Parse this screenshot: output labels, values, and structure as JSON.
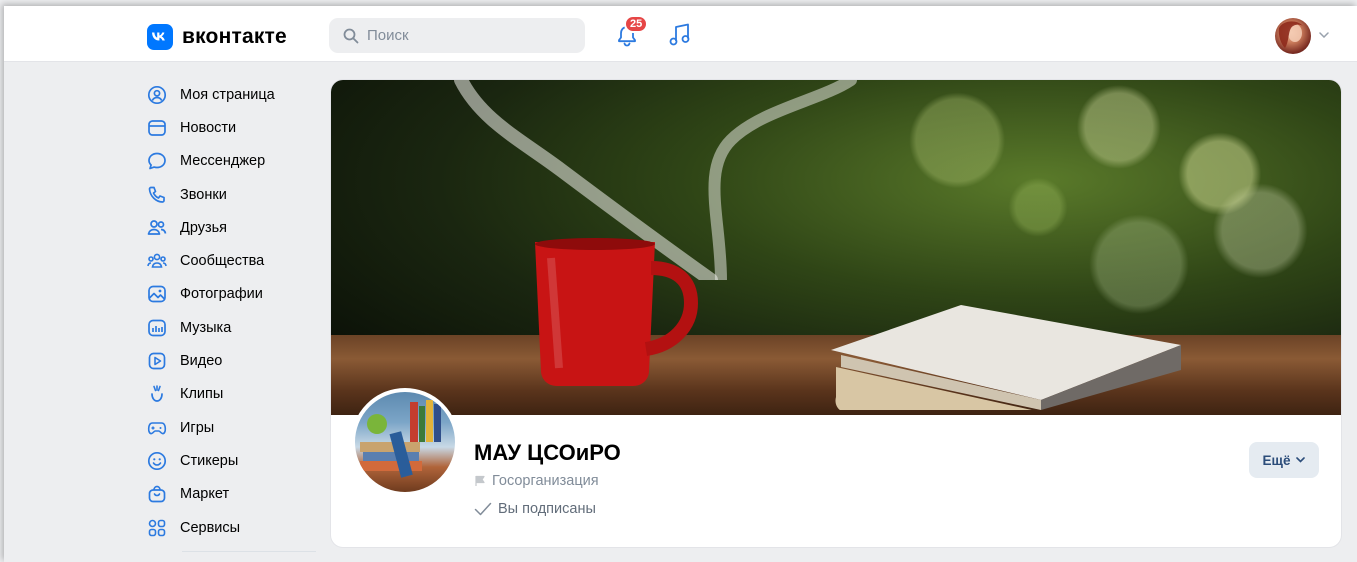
{
  "header": {
    "logo_text": "вконтакте",
    "search_placeholder": "Поиск",
    "notifications_count": "25"
  },
  "sidebar": {
    "items": [
      {
        "label": "Моя страница",
        "icon": "user-circle-icon"
      },
      {
        "label": "Новости",
        "icon": "newspaper-icon"
      },
      {
        "label": "Мессенджер",
        "icon": "message-icon"
      },
      {
        "label": "Звонки",
        "icon": "phone-icon"
      },
      {
        "label": "Друзья",
        "icon": "friends-icon"
      },
      {
        "label": "Сообщества",
        "icon": "communities-icon"
      },
      {
        "label": "Фотографии",
        "icon": "photo-icon"
      },
      {
        "label": "Музыка",
        "icon": "music-icon"
      },
      {
        "label": "Видео",
        "icon": "video-icon"
      },
      {
        "label": "Клипы",
        "icon": "clips-icon"
      },
      {
        "label": "Игры",
        "icon": "gamepad-icon"
      },
      {
        "label": "Стикеры",
        "icon": "smile-icon"
      },
      {
        "label": "Маркет",
        "icon": "bag-icon"
      },
      {
        "label": "Сервисы",
        "icon": "services-icon"
      }
    ]
  },
  "profile": {
    "name": "МАУ ЦСОиРО",
    "type": "Госорганизация",
    "subscription_status": "Вы подписаны",
    "more_label": "Ещё"
  },
  "colors": {
    "accent": "#0077ff",
    "badge": "#e64646",
    "icon": "#2c7ae0"
  }
}
